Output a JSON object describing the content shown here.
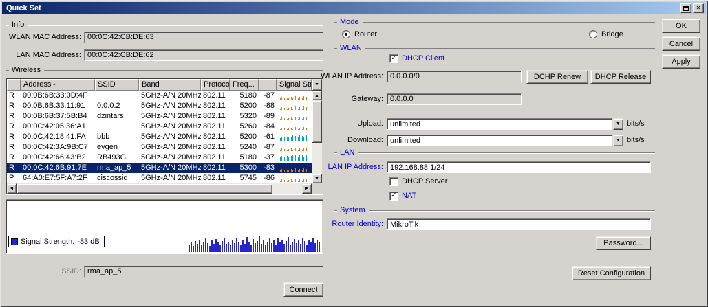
{
  "window": {
    "title": "Quick Set"
  },
  "actions": {
    "ok": "OK",
    "cancel": "Cancel",
    "apply": "Apply"
  },
  "icons": {
    "close": "✕",
    "dropdown": "▼",
    "scroll_up": "▲",
    "scroll_down": "▼",
    "scroll_left": "◄",
    "scroll_right": "►",
    "check": "✓",
    "sort_asc": "▴"
  },
  "colors": {
    "title_gradient_start": "#0a246a",
    "title_gradient_end": "#a6caf0",
    "selected_row": "#0a246a",
    "label_blue": "#0000d4",
    "signal_low": "#f07800",
    "signal_high": "#00a8b0",
    "histogram_bar": "#2626cc",
    "face": "#d6d3ce"
  },
  "info": {
    "legend": "Info",
    "wlan_mac_label": "WLAN MAC Address:",
    "wlan_mac": "00:0C:42:CB:DE:63",
    "lan_mac_label": "LAN MAC Address:",
    "lan_mac": "00:0C:42:CB:DE:62"
  },
  "wireless": {
    "legend": "Wireless",
    "columns": [
      "",
      "Address",
      "SSID",
      "Band",
      "Protocol",
      "Freq...",
      "",
      "Signal Stre"
    ],
    "rows": [
      {
        "flag": "R",
        "address": "00:0B:6B:33:0D:4F",
        "ssid": "",
        "band": "5GHz-A/N 20MHz",
        "protocol": "802.11",
        "freq": "5180",
        "signal": "-87",
        "level": "low",
        "selected": false
      },
      {
        "flag": "R",
        "address": "00:0B:6B:33:11:91",
        "ssid": "0.0.0.2",
        "band": "5GHz-A/N 20MHz",
        "protocol": "802.11",
        "freq": "5200",
        "signal": "-88",
        "level": "low",
        "selected": false
      },
      {
        "flag": "R",
        "address": "00:0B:6B:37:5B:B4",
        "ssid": "dzintars",
        "band": "5GHz-A/N 20MHz",
        "protocol": "802.11",
        "freq": "5320",
        "signal": "-89",
        "level": "low",
        "selected": false
      },
      {
        "flag": "R",
        "address": "00:0C:42:05:36:A1",
        "ssid": "",
        "band": "5GHz-A/N 20MHz",
        "protocol": "802.11",
        "freq": "5260",
        "signal": "-84",
        "level": "low",
        "selected": false
      },
      {
        "flag": "R",
        "address": "00:0C:42:18:41:FA",
        "ssid": "bbb",
        "band": "5GHz-A/N 20MHz",
        "protocol": "802.11",
        "freq": "5200",
        "signal": "-61",
        "level": "mid",
        "selected": false
      },
      {
        "flag": "R",
        "address": "00:0C:42:3A:9B:C7",
        "ssid": "evgen",
        "band": "5GHz-A/N 20MHz",
        "protocol": "802.11",
        "freq": "5240",
        "signal": "-87",
        "level": "low",
        "selected": false
      },
      {
        "flag": "R",
        "address": "00:0C:42:66:43:B2",
        "ssid": "RB493G",
        "band": "5GHz-A/N 20MHz",
        "protocol": "802.11",
        "freq": "5180",
        "signal": "-37",
        "level": "high",
        "selected": false
      },
      {
        "flag": "R",
        "address": "00:0C:42:6B:91:7E",
        "ssid": "rma_ap_5",
        "band": "5GHz-A/N 20MHz",
        "protocol": "802.11",
        "freq": "5300",
        "signal": "-83",
        "level": "low",
        "selected": true
      },
      {
        "flag": "P",
        "address": "64:A0:E7:5F:A7:2F",
        "ssid": "ciscossid",
        "band": "5GHz-A/N 20MHz",
        "protocol": "802.11",
        "freq": "5745",
        "signal": "-86",
        "level": "low",
        "selected": false
      }
    ],
    "bar_patterns": {
      "low": [
        3,
        2,
        4,
        2,
        3,
        5,
        2,
        3,
        2,
        4,
        2,
        3,
        5,
        3,
        2,
        4,
        3,
        2,
        5,
        3,
        4
      ],
      "mid": [
        5,
        4,
        6,
        7,
        5,
        8,
        6,
        5,
        7,
        6,
        8,
        5,
        7,
        6,
        5,
        8,
        6,
        7,
        5,
        7,
        8
      ],
      "high": [
        7,
        6,
        8,
        9,
        7,
        10,
        8,
        7,
        9,
        8,
        10,
        7,
        9,
        8,
        7,
        10,
        8,
        9,
        7,
        9,
        10
      ]
    },
    "ssid_label": "SSID:",
    "ssid_value": "rma_ap_5",
    "connect_label": "Connect"
  },
  "graph": {
    "legend_label": "Signal Strength:",
    "legend_value": "-83 dB",
    "bars": [
      10,
      14,
      9,
      16,
      12,
      18,
      11,
      15,
      20,
      13,
      9,
      17,
      12,
      19,
      14,
      10,
      16,
      21,
      12,
      15,
      11,
      18,
      13,
      20,
      15,
      10,
      17,
      12,
      22,
      14,
      11,
      19,
      13,
      16,
      24,
      12,
      18,
      11,
      15,
      20,
      13,
      17,
      10,
      21,
      14,
      18,
      12,
      16,
      22,
      11,
      15,
      19,
      13,
      17,
      12,
      20,
      16,
      10,
      18,
      14,
      21,
      13,
      17,
      15
    ]
  },
  "mode": {
    "legend": "Mode",
    "router": "Router",
    "bridge": "Bridge"
  },
  "wlan": {
    "legend": "WLAN",
    "dhcp_client_label": "DHCP Client",
    "ip_label": "WLAN IP Address:",
    "ip_value": "0.0.0.0/0",
    "dhcp_renew_label": "DCHP Renew",
    "dhcp_release_label": "DHCP Release",
    "gateway_label": "Gateway:",
    "gateway_value": "0.0.0.0",
    "upload_label": "Upload:",
    "upload_value": "unlimited",
    "upload_unit": "bits/s",
    "download_label": "Download:",
    "download_value": "unlimited",
    "download_unit": "bits/s"
  },
  "lan": {
    "legend": "LAN",
    "ip_label": "LAN IP Address:",
    "ip_value": "192.168.88.1/24",
    "dhcp_server_label": "DHCP Server",
    "nat_label": "NAT"
  },
  "system": {
    "legend": "System",
    "identity_label": "Router Identity:",
    "identity_value": "MikroTik",
    "password_label": "Password...",
    "reset_label": "Reset Configuration"
  }
}
